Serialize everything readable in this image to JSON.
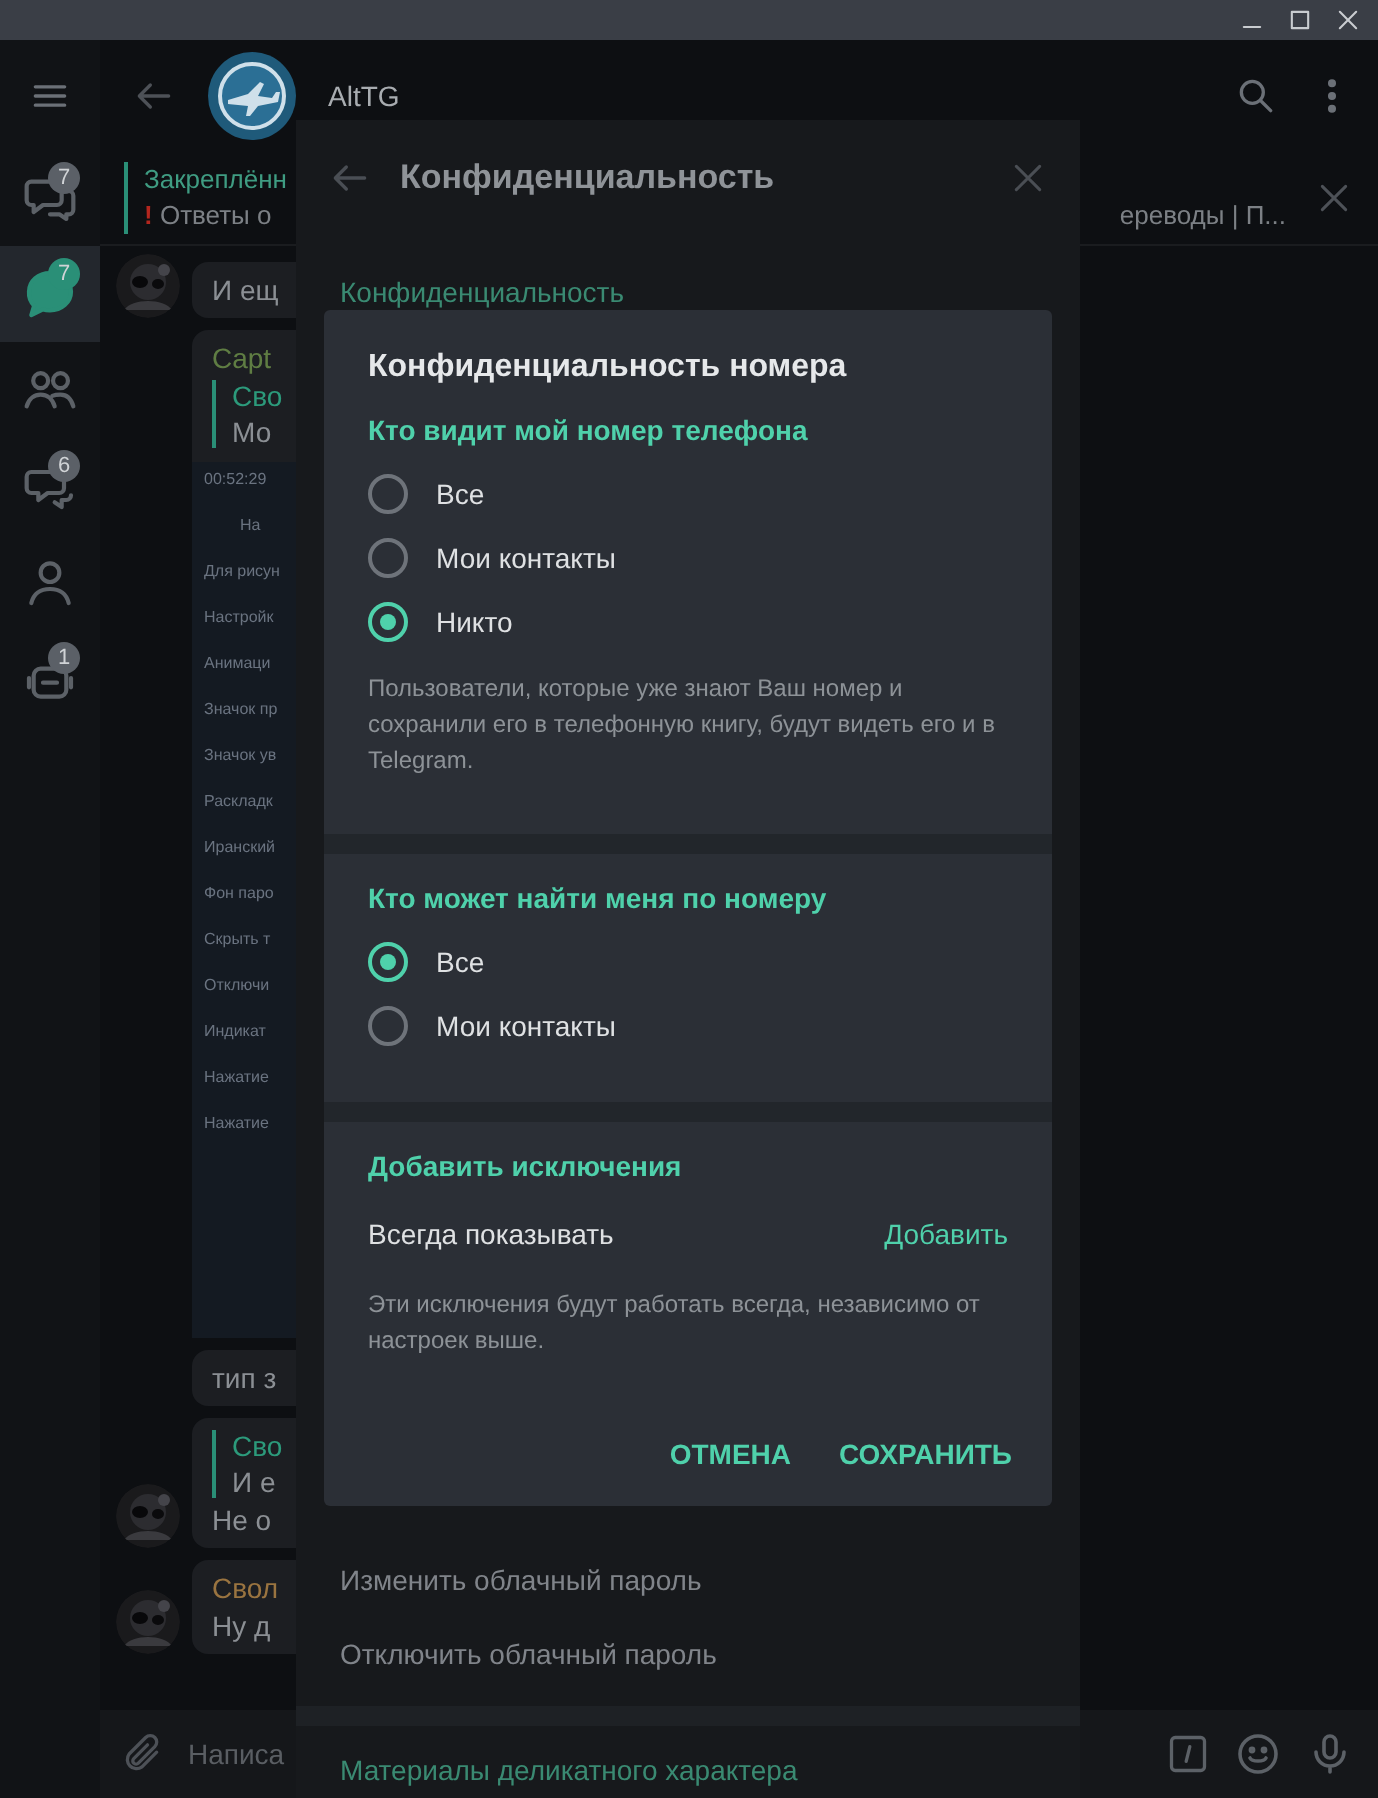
{
  "rail": {
    "items": [
      {
        "badge": "7",
        "selected": false
      },
      {
        "badge": "7",
        "selected": true
      },
      {
        "selected": false
      },
      {
        "badge": "6",
        "selected": false
      },
      {
        "selected": false
      },
      {
        "badge": "1",
        "selected": false
      }
    ]
  },
  "chat": {
    "title": "AltTG",
    "pinned": {
      "label": "Закреплённ",
      "alert": "!",
      "text_start": "Ответы о",
      "text_end": "ереводы | П..."
    },
    "messages": [
      {
        "kind": "text",
        "avatar": true,
        "text": "И ещ"
      },
      {
        "kind": "media",
        "avatar": false,
        "sender": "Capt",
        "color": "#5f7d43",
        "reply_name": "Сво",
        "reply_text": "Мо",
        "screenshot": {
          "time": "00:52:29",
          "title": "На",
          "lines": [
            "Для рисун",
            "Настройк",
            "Анимаци",
            "Значок пр",
            "Значок ув",
            "Раскладк",
            "Иранский",
            "Фон паро",
            "Скрыть т",
            "Отключи",
            "Индикат",
            "Нажатие",
            "Нажатие"
          ]
        }
      },
      {
        "kind": "text",
        "avatar": false,
        "text": "тип з"
      },
      {
        "kind": "reply",
        "avatar": true,
        "reply_name": "Сво",
        "reply_text": "И е",
        "text": "Не о"
      },
      {
        "kind": "named",
        "avatar": true,
        "sender": "Свол",
        "color": "#9a7440",
        "text": "Ну д"
      }
    ],
    "input": {
      "placeholder": "Написа"
    }
  },
  "settings": {
    "title": "Конфиденциальность",
    "section": "Конфиденциальность",
    "items": [
      "Изменить облачный пароль",
      "Отключить облачный пароль"
    ],
    "next_section": "Материалы деликатного характера"
  },
  "dialog": {
    "title": "Конфиденциальность номера",
    "sections": [
      {
        "header": "Кто видит мой номер телефона",
        "options": [
          {
            "label": "Все",
            "selected": false
          },
          {
            "label": "Мои контакты",
            "selected": false
          },
          {
            "label": "Никто",
            "selected": true
          }
        ],
        "note": "Пользователи, которые уже знают Ваш номер и сохранили его в телефонную книгу, будут видеть его и в Telegram."
      },
      {
        "header": "Кто может найти меня по номеру",
        "options": [
          {
            "label": "Все",
            "selected": true
          },
          {
            "label": "Мои контакты",
            "selected": false
          }
        ]
      }
    ],
    "exceptions": {
      "header": "Добавить исключения",
      "row_label": "Всегда показывать",
      "row_action": "Добавить",
      "note": "Эти исключения будут работать всегда, независимо от настроек выше."
    },
    "buttons": [
      "ОТМЕНА",
      "СОХРАНИТЬ"
    ]
  }
}
